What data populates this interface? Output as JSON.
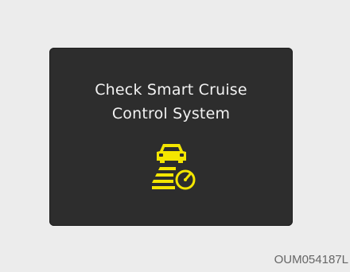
{
  "display": {
    "line1": "Check Smart Cruise",
    "line2": "Control System",
    "icon": "smart-cruise-control-warning-icon",
    "text_color": "#f2f2f2",
    "icon_color": "#f4e600",
    "background_color": "#2d2d2d"
  },
  "caption": {
    "code": "OUM054187L"
  }
}
